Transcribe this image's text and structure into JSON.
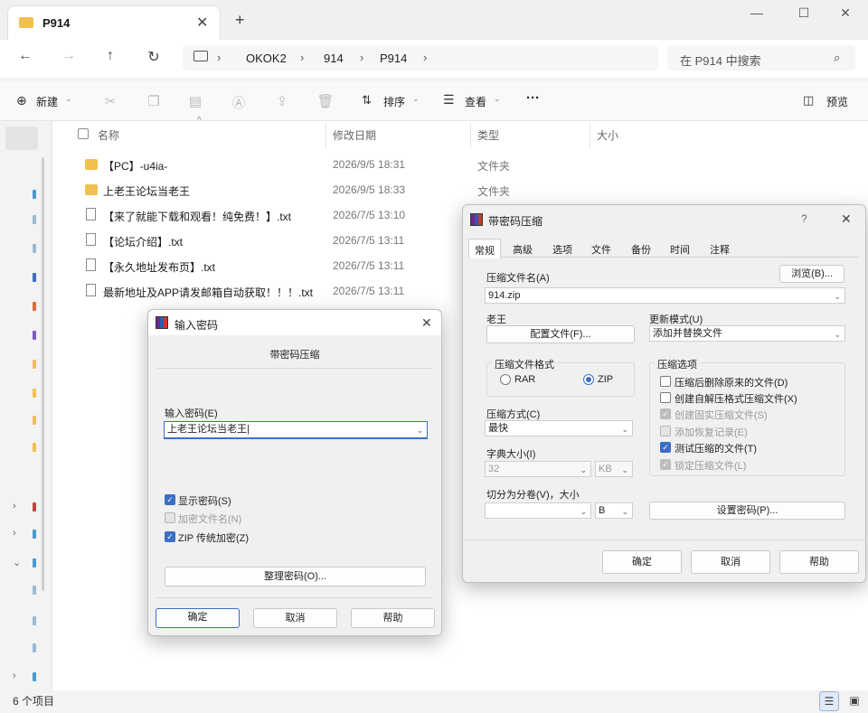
{
  "explorer": {
    "tab_title": "P914",
    "new_tab": "+",
    "window_controls": {
      "minimize": "—",
      "maximize": "☐",
      "close": "✕"
    },
    "nav": {
      "back": "←",
      "forward": "→",
      "up": "↑",
      "refresh": "↻"
    },
    "breadcrumb": [
      "OKOK2",
      "914",
      "P914"
    ],
    "search_placeholder": "在 P914 中搜索",
    "toolbar": {
      "new": "新建",
      "sort": "排序",
      "view": "查看",
      "more": "···",
      "preview": "预览"
    },
    "columns": {
      "name": "名称",
      "modified": "修改日期",
      "type": "类型",
      "size": "大小"
    },
    "files": [
      {
        "name": "【PC】-u4ia-",
        "date": "2026/9/5 18:31",
        "type": "文件夹",
        "kind": "folder"
      },
      {
        "name": "上老王论坛当老王",
        "date": "2026/9/5 18:33",
        "type": "文件夹",
        "kind": "folder"
      },
      {
        "name": "【来了就能下载和观看！纯免费！】.txt",
        "date": "2026/7/5 13:10",
        "type": "",
        "kind": "txt"
      },
      {
        "name": "【论坛介绍】.txt",
        "date": "2026/7/5 13:11",
        "type": "",
        "kind": "txt"
      },
      {
        "name": "【永久地址发布页】.txt",
        "date": "2026/7/5 13:11",
        "type": "",
        "kind": "txt"
      },
      {
        "name": "最新地址及APP请发邮箱自动获取！！！.txt",
        "date": "2026/7/5 13:11",
        "type": "",
        "kind": "txt"
      }
    ],
    "status": "6 个项目"
  },
  "archive_dialog": {
    "title": "带密码压缩",
    "help": "?",
    "close": "✕",
    "tabs": [
      "常规",
      "高级",
      "选项",
      "文件",
      "备份",
      "时间",
      "注释"
    ],
    "archive_name_label": "压缩文件名(A)",
    "archive_name": "914.zip",
    "browse": "浏览(B)...",
    "profile_label": "老王",
    "profile_button": "配置文件(F)...",
    "update_mode_label": "更新模式(U)",
    "update_mode": "添加并替换文件",
    "format_label": "压缩文件格式",
    "format_rar": "RAR",
    "format_zip": "ZIP",
    "options_label": "压缩选项",
    "options": [
      {
        "label": "压缩后删除原来的文件(D)",
        "checked": false,
        "disabled": false
      },
      {
        "label": "创建自解压格式压缩文件(X)",
        "checked": false,
        "disabled": false
      },
      {
        "label": "创建固实压缩文件(S)",
        "checked": true,
        "disabled": true
      },
      {
        "label": "添加恢复记录(E)",
        "checked": false,
        "disabled": true
      },
      {
        "label": "测试压缩的文件(T)",
        "checked": true,
        "disabled": false
      },
      {
        "label": "锁定压缩文件(L)",
        "checked": true,
        "disabled": true
      }
    ],
    "method_label": "压缩方式(C)",
    "method": "最快",
    "dict_label": "字典大小(I)",
    "dict_value": "32",
    "dict_unit": "KB",
    "split_label": "切分为分卷(V)，大小",
    "split_value": "",
    "split_unit": "B",
    "set_password": "设置密码(P)...",
    "ok": "确定",
    "cancel": "取消",
    "helpbtn": "帮助"
  },
  "password_dialog": {
    "title": "输入密码",
    "close": "✕",
    "subtitle": "带密码压缩",
    "enter_label": "输入密码(E)",
    "password_value": "上老王论坛当老王",
    "show_password": "显示密码(S)",
    "encrypt_names": "加密文件名(N)",
    "zip_legacy": "ZIP 传统加密(Z)",
    "organize": "整理密码(O)...",
    "ok": "确定",
    "cancel": "取消",
    "help": "帮助"
  },
  "colors": {
    "accent": "#3b6fc4",
    "folder": "#f2c04e",
    "winrar_purple": "#6b2a8f"
  }
}
